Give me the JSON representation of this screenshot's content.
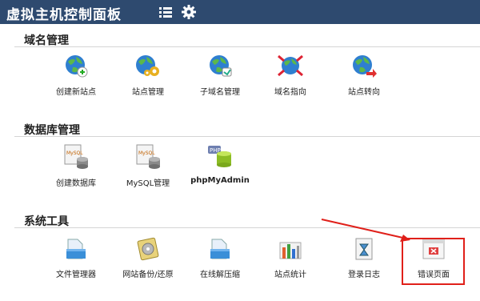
{
  "header": {
    "title": "虚拟主机控制面板",
    "menu_icon": "list-icon",
    "settings_icon": "gear-icon"
  },
  "sections": [
    {
      "title": "域名管理",
      "items": [
        {
          "label": "创建新站点",
          "icon": "globe-add-icon"
        },
        {
          "label": "站点管理",
          "icon": "globe-gear-icon"
        },
        {
          "label": "子域名管理",
          "icon": "globe-sub-icon"
        },
        {
          "label": "域名指向",
          "icon": "globe-point-icon"
        },
        {
          "label": "站点转向",
          "icon": "globe-redirect-icon"
        }
      ]
    },
    {
      "title": "数据库管理",
      "items": [
        {
          "label": "创建数据库",
          "icon": "mysql-create-icon"
        },
        {
          "label": "MySQL管理",
          "icon": "mysql-manage-icon"
        },
        {
          "label": "phpMyAdmin",
          "icon": "php-db-icon"
        }
      ]
    },
    {
      "title": "系统工具",
      "items": [
        {
          "label": "文件管理器",
          "icon": "file-manager-icon"
        },
        {
          "label": "网站备份/还原",
          "icon": "backup-icon"
        },
        {
          "label": "在线解压缩",
          "icon": "unzip-icon"
        },
        {
          "label": "站点统计",
          "icon": "stats-icon"
        },
        {
          "label": "登录日志",
          "icon": "log-icon"
        },
        {
          "label": "错误页面",
          "icon": "error-page-icon"
        }
      ]
    }
  ],
  "colors": {
    "header_bg": "#2e4a6f",
    "highlight": "#e0201a"
  }
}
